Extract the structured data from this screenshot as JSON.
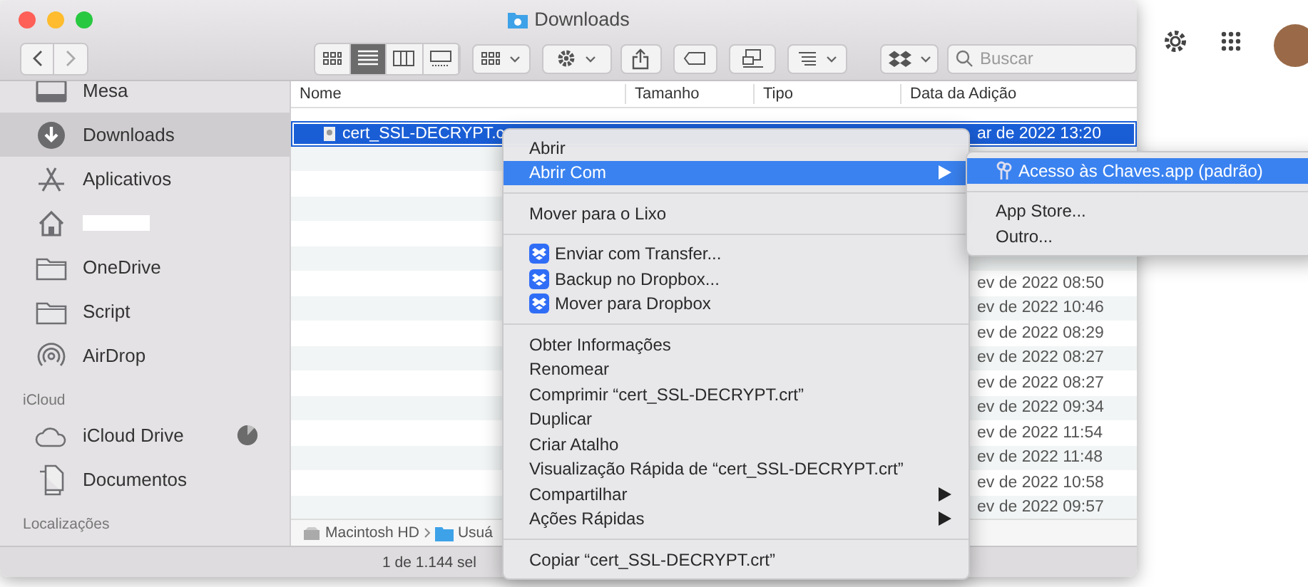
{
  "window": {
    "title": "Downloads"
  },
  "toolbar": {
    "view_modes": [
      {
        "kind": "icons",
        "selected": false
      },
      {
        "kind": "list",
        "selected": true
      },
      {
        "kind": "columns",
        "selected": false
      },
      {
        "kind": "gallery",
        "selected": false
      }
    ],
    "search": {
      "placeholder": "Buscar"
    }
  },
  "sidebar": {
    "sections": [
      {
        "items": [
          {
            "kind": "desktop",
            "label": "Mesa",
            "selected": false
          },
          {
            "kind": "downloads",
            "label": "Downloads",
            "selected": true
          },
          {
            "kind": "apps",
            "label": "Aplicativos",
            "selected": false
          },
          {
            "kind": "home",
            "redacted": true,
            "selected": false
          },
          {
            "kind": "folder",
            "label": "OneDrive",
            "selected": false
          },
          {
            "kind": "folder",
            "label": "Script",
            "selected": false
          },
          {
            "kind": "airdrop",
            "label": "AirDrop",
            "selected": false
          }
        ]
      },
      {
        "heading": "iCloud",
        "items": [
          {
            "kind": "cloud",
            "label": "iCloud Drive",
            "selected": false,
            "level": 0.88
          },
          {
            "kind": "document",
            "label": "Documentos",
            "selected": false
          }
        ]
      },
      {
        "heading": "Localizações"
      }
    ]
  },
  "table": {
    "columns": [
      "Nome",
      "Tamanho",
      "Tipo",
      "Data da Adição"
    ],
    "rows": [
      {
        "name": "cert_SSL-DECRYPT.c",
        "date": "ar de 2022 13:20",
        "selected": true
      },
      {
        "selected": false
      },
      {
        "selected": false
      },
      {
        "selected": false
      },
      {
        "selected": false
      },
      {
        "selected": false
      },
      {
        "date": "ev de 2022 08:50",
        "selected": false
      },
      {
        "date": "ev de 2022 10:46",
        "selected": false
      },
      {
        "date": "ev de 2022 08:29",
        "selected": false
      },
      {
        "date": "ev de 2022 08:27",
        "selected": false
      },
      {
        "date": "ev de 2022 08:27",
        "selected": false
      },
      {
        "date": "ev de 2022 09:34",
        "selected": false
      },
      {
        "date": "ev de 2022 11:54",
        "selected": false
      },
      {
        "date": "ev de 2022 11:48",
        "selected": false
      },
      {
        "date": "ev de 2022 10:58",
        "selected": false
      },
      {
        "date": "ev de 2022 09:57",
        "selected": false
      }
    ]
  },
  "path_bar": [
    "Macintosh HD",
    "Usuá"
  ],
  "status_bar": "1 de 1.144 sel",
  "context_menu": {
    "items": [
      {
        "kind": "item",
        "label": "Abrir",
        "selected": false
      },
      {
        "kind": "item",
        "label": "Abrir Com",
        "selected": true,
        "has_submenu": true
      },
      {
        "kind": "separator"
      },
      {
        "kind": "item",
        "label": "Mover para o Lixo",
        "selected": false
      },
      {
        "kind": "separator"
      },
      {
        "kind": "dropbox",
        "label": "Enviar com Transfer...",
        "selected": false
      },
      {
        "kind": "dropbox",
        "label": "Backup no Dropbox...",
        "selected": false
      },
      {
        "kind": "dropbox",
        "label": "Mover para Dropbox",
        "selected": false
      },
      {
        "kind": "separator"
      },
      {
        "kind": "item",
        "label": "Obter Informações",
        "selected": false
      },
      {
        "kind": "item",
        "label": "Renomear",
        "selected": false
      },
      {
        "kind": "item",
        "label": "Comprimir “cert_SSL-DECRYPT.crt”",
        "selected": false
      },
      {
        "kind": "item",
        "label": "Duplicar",
        "selected": false
      },
      {
        "kind": "item",
        "label": "Criar Atalho",
        "selected": false
      },
      {
        "kind": "item",
        "label": "Visualização Rápida de “cert_SSL-DECRYPT.crt”",
        "selected": false
      },
      {
        "kind": "item",
        "label": "Compartilhar",
        "selected": false,
        "has_submenu": true
      },
      {
        "kind": "item",
        "label": "Ações Rápidas",
        "selected": false,
        "has_submenu": true
      },
      {
        "kind": "separator"
      },
      {
        "kind": "item",
        "label": "Copiar “cert_SSL-DECRYPT.crt”",
        "selected": false
      }
    ]
  },
  "submenu": {
    "items": [
      {
        "kind": "app",
        "label": "Acesso às Chaves.app (padrão)",
        "selected": true
      },
      {
        "kind": "separator"
      },
      {
        "kind": "item",
        "label": "App Store...",
        "selected": false
      },
      {
        "kind": "item",
        "label": "Outro...",
        "selected": false
      }
    ]
  }
}
